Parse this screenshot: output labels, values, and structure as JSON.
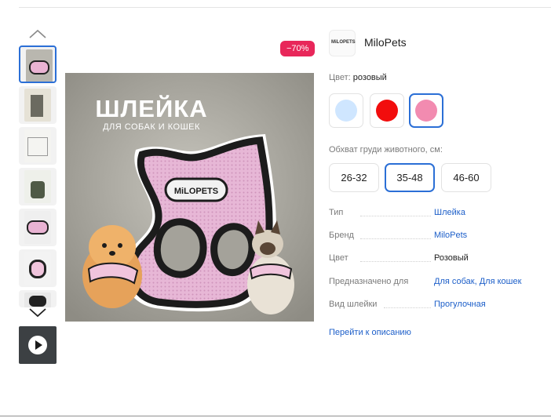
{
  "gallery": {
    "badge": "−70%",
    "image_title": "ШЛЕЙКА",
    "image_subtitle": "ДЛЯ СОБАК И КОШЕК",
    "image_logo": "MiLOPETS",
    "thumb_count": 7
  },
  "brand": {
    "logo_text": "MiLOPETS",
    "name": "MiloPets"
  },
  "colors": {
    "label": "Цвет:",
    "selected": "розовый",
    "options": [
      "#cfe6ff",
      "#f20d0d",
      "#f28bb0"
    ]
  },
  "sizes": {
    "label": "Обхват груди животного, см:",
    "options": [
      "26-32",
      "35-48",
      "46-60"
    ],
    "selected": "35-48"
  },
  "specs": [
    {
      "key": "Тип",
      "value": "Шлейка"
    },
    {
      "key": "Бренд",
      "value": "MiloPets"
    },
    {
      "key": "Цвет",
      "value": "Розовый"
    },
    {
      "key": "Предназначено для",
      "value": "Для собак, Для кошек"
    },
    {
      "key": "Вид шлейки",
      "value": "Прогулочная"
    }
  ],
  "links": {
    "description": "Перейти к описанию"
  },
  "theme": {
    "accent": "#2b6fd6",
    "link": "#1d5fc9",
    "badge": "#e8275a"
  }
}
